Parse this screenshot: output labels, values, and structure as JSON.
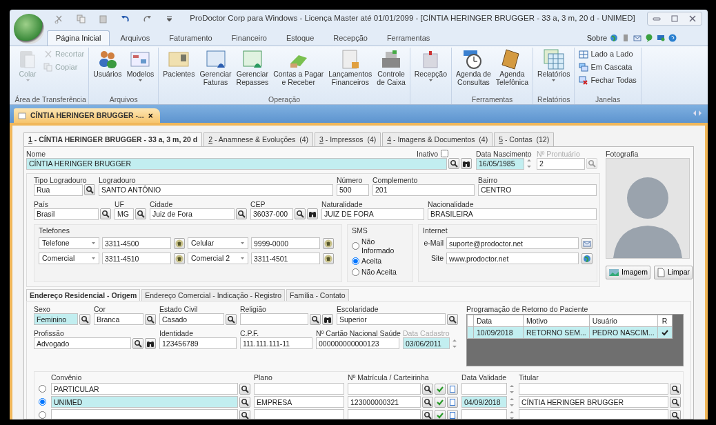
{
  "window": {
    "title": "ProDoctor Corp para Windows - Licença Master até 01/01/2099 - [CÍNTIA HERINGER BRUGGER - 33 a, 3 m, 20 d - UNIMED]"
  },
  "ribbon_tabs": [
    {
      "label": "Página Inicial",
      "selected": true
    },
    {
      "label": "Arquivos",
      "selected": false
    },
    {
      "label": "Faturamento",
      "selected": false
    },
    {
      "label": "Financeiro",
      "selected": false
    },
    {
      "label": "Estoque",
      "selected": false
    },
    {
      "label": "Recepção",
      "selected": false
    },
    {
      "label": "Ferramentas",
      "selected": false
    }
  ],
  "help": {
    "label": "Sobre"
  },
  "ribbon_groups": [
    {
      "label": "Área de Transferência",
      "items": [
        {
          "label": "Colar",
          "kind": "large",
          "disabled": true,
          "dropdown": true
        },
        {
          "label": "Recortar",
          "kind": "small",
          "disabled": true
        },
        {
          "label": "Copiar",
          "kind": "small",
          "disabled": true
        }
      ]
    },
    {
      "label": "Arquivos",
      "items": [
        {
          "label": "Usuários",
          "kind": "large",
          "disabled": false,
          "dropdown": false
        },
        {
          "label": "Modelos",
          "kind": "large",
          "disabled": false,
          "dropdown": true
        }
      ]
    },
    {
      "label": "Operação",
      "items": [
        {
          "label": "Pacientes",
          "kind": "large",
          "disabled": false,
          "dropdown": false
        },
        {
          "label": "Gerenciar\nFaturas",
          "kind": "large",
          "disabled": false,
          "dropdown": false
        },
        {
          "label": "Gerenciar\nRepasses",
          "kind": "large",
          "disabled": false,
          "dropdown": false
        },
        {
          "label": "Contas a Pagar\ne Receber",
          "kind": "large",
          "disabled": false,
          "dropdown": false
        },
        {
          "label": "Lançamentos\nFinanceiros",
          "kind": "large",
          "disabled": false,
          "dropdown": false
        },
        {
          "label": "Controle\nde Caixa",
          "kind": "large",
          "disabled": false,
          "dropdown": false
        }
      ]
    },
    {
      "items": [
        {
          "label": "Recepção",
          "kind": "large",
          "disabled": false,
          "dropdown": true
        }
      ]
    },
    {
      "label": "Ferramentas",
      "items": [
        {
          "label": "Agenda de\nConsultas",
          "kind": "large",
          "disabled": false,
          "dropdown": false
        },
        {
          "label": "Agenda\nTelefônica",
          "kind": "large",
          "disabled": false,
          "dropdown": false
        }
      ]
    },
    {
      "label": "Relatórios",
      "items": [
        {
          "label": "Relatórios",
          "kind": "large",
          "disabled": false,
          "dropdown": true
        }
      ]
    },
    {
      "label": "Janelas",
      "items": [
        {
          "label": "Lado a Lado",
          "kind": "small",
          "disabled": false
        },
        {
          "label": "Em Cascata",
          "kind": "small",
          "disabled": false
        },
        {
          "label": "Fechar Todas",
          "kind": "small",
          "disabled": false
        }
      ]
    }
  ],
  "document_tab": {
    "label": "CÍNTIA HERINGER BRUGGER -...",
    "close": "×"
  },
  "record_tabs": [
    {
      "hotkey": "1",
      "label": " - CÍNTIA HERINGER BRUGGER - 33 a, 3 m, 20 d",
      "selected": true
    },
    {
      "hotkey": "2",
      "label": " - Anamnese & Evoluções  (4)",
      "selected": false
    },
    {
      "hotkey": "3",
      "label": " - Impressos  (4)",
      "selected": false
    },
    {
      "hotkey": "4",
      "label": " - Imagens & Documentos  (4)",
      "selected": false
    },
    {
      "hotkey": "5",
      "label": " - Contas  (12)",
      "selected": false
    }
  ],
  "patient": {
    "name": {
      "label": "Nome",
      "value": "CÍNTIA HERINGER BRUGGER",
      "highlight": true,
      "kind": "lookup_find"
    },
    "inactive": {
      "label": "Inativo",
      "checked": false
    },
    "birth_date": {
      "label": "Data Nascimento",
      "value": "16/05/1985",
      "highlight": true,
      "kind": "date"
    },
    "record_number": {
      "label": "Nº Prontuário",
      "value": "2",
      "kind": "lookup",
      "disabled": true
    }
  },
  "photo": {
    "label": "Fotografia",
    "buttons": [
      {
        "label": "Imagem"
      },
      {
        "label": "Limpar"
      }
    ]
  },
  "address": {
    "street_line": [
      {
        "label": "Tipo Logradouro",
        "value": "Rua",
        "kind": "lookup"
      },
      {
        "label": "Logradouro",
        "value": "SANTO ANTÔNIO",
        "kind": "text"
      },
      {
        "label": "Número",
        "value": "500",
        "kind": "text"
      },
      {
        "label": "Complemento",
        "value": "201",
        "kind": "text"
      },
      {
        "label": "Bairro",
        "value": "CENTRO",
        "kind": "text"
      }
    ],
    "city_line": [
      {
        "label": "País",
        "value": "Brasil",
        "kind": "lookup"
      },
      {
        "label": "UF",
        "value": "MG",
        "kind": "lookup"
      },
      {
        "label": "Cidade",
        "value": "Juiz de Fora",
        "kind": "lookup"
      },
      {
        "label": "CEP",
        "value": "36037-000",
        "kind": "lookup_find"
      },
      {
        "label": "Naturalidade",
        "value": "JUIZ DE FORA",
        "kind": "text"
      },
      {
        "label": "Nacionalidade",
        "value": "BRASILEIRA",
        "kind": "text"
      }
    ]
  },
  "phones": {
    "label": "Telefones",
    "rows": [
      [
        {
          "type": "Telefone",
          "number": "3311-4500"
        },
        {
          "type": "Celular",
          "number": "9999-0000"
        }
      ],
      [
        {
          "type": "Comercial",
          "number": "3311-4510"
        },
        {
          "type": "Comercial 2",
          "number": "3311-4501"
        }
      ]
    ]
  },
  "sms": {
    "label": "SMS",
    "options": [
      {
        "label": "Não Informado",
        "selected": false
      },
      {
        "label": "Aceita",
        "selected": true
      },
      {
        "label": "Não Aceita",
        "selected": false
      }
    ]
  },
  "internet": {
    "label": "Internet",
    "fields": [
      {
        "label": "e-Mail",
        "value": "suporte@prodoctor.net"
      },
      {
        "label": "Site",
        "value": "www.prodoctor.net"
      }
    ]
  },
  "section_tabs": [
    {
      "label": "Endereço Residencial - Origem",
      "selected": true
    },
    {
      "label": "Endereço Comercial - Indicação - Registro",
      "selected": false
    },
    {
      "label": "Família - Contato",
      "selected": false
    }
  ],
  "personal": {
    "first_line": [
      {
        "label": "Sexo",
        "value": "Feminino",
        "highlight": true,
        "kind": "lookup"
      },
      {
        "label": "Cor",
        "value": "Branca",
        "kind": "lookup"
      },
      {
        "label": "Estado Civil",
        "value": "Casado",
        "kind": "lookup"
      },
      {
        "label": "Religião",
        "kind": "lookup_find"
      },
      {
        "label": "Escolaridade",
        "value": "Superior",
        "kind": "lookup"
      }
    ],
    "second_line": [
      {
        "label": "Profissão",
        "value": "Advogado",
        "kind": "lookup_find"
      },
      {
        "label": "Identidade",
        "value": "123456789",
        "kind": "text"
      },
      {
        "label": "C.P.F.",
        "value": "111.111.111-11",
        "kind": "text"
      },
      {
        "label": "Nº Cartão Nacional Saúde",
        "value": "000000000000123",
        "kind": "text"
      },
      {
        "label": "Data Cadastro",
        "value": "03/06/2011",
        "highlight": true,
        "kind": "date",
        "disabled": true
      }
    ]
  },
  "return_schedule": {
    "label": "Programação de Retorno do Paciente",
    "columns": [
      "Data",
      "Motivo",
      "Usuário",
      "R"
    ],
    "rows": [
      {
        "cells": [
          "10/09/2018",
          "RETORNO SEM...",
          "PEDRO NASCIM..."
        ],
        "checked": true,
        "selected": true
      }
    ]
  },
  "insurance": {
    "columns": [
      "Convênio",
      "Plano",
      "Nº Matrícula / Carteirinha",
      "Data Validade",
      "Titular"
    ],
    "rows": [
      {
        "selected": false,
        "insurer": "PARTICULAR"
      },
      {
        "selected": true,
        "insurer": "UNIMED",
        "plan": "EMPRESA",
        "card": "123000000321",
        "valid_until": "04/09/2018",
        "holder": "CÍNTIA HERINGER BRUGGER"
      },
      {
        "selected": false
      }
    ]
  }
}
